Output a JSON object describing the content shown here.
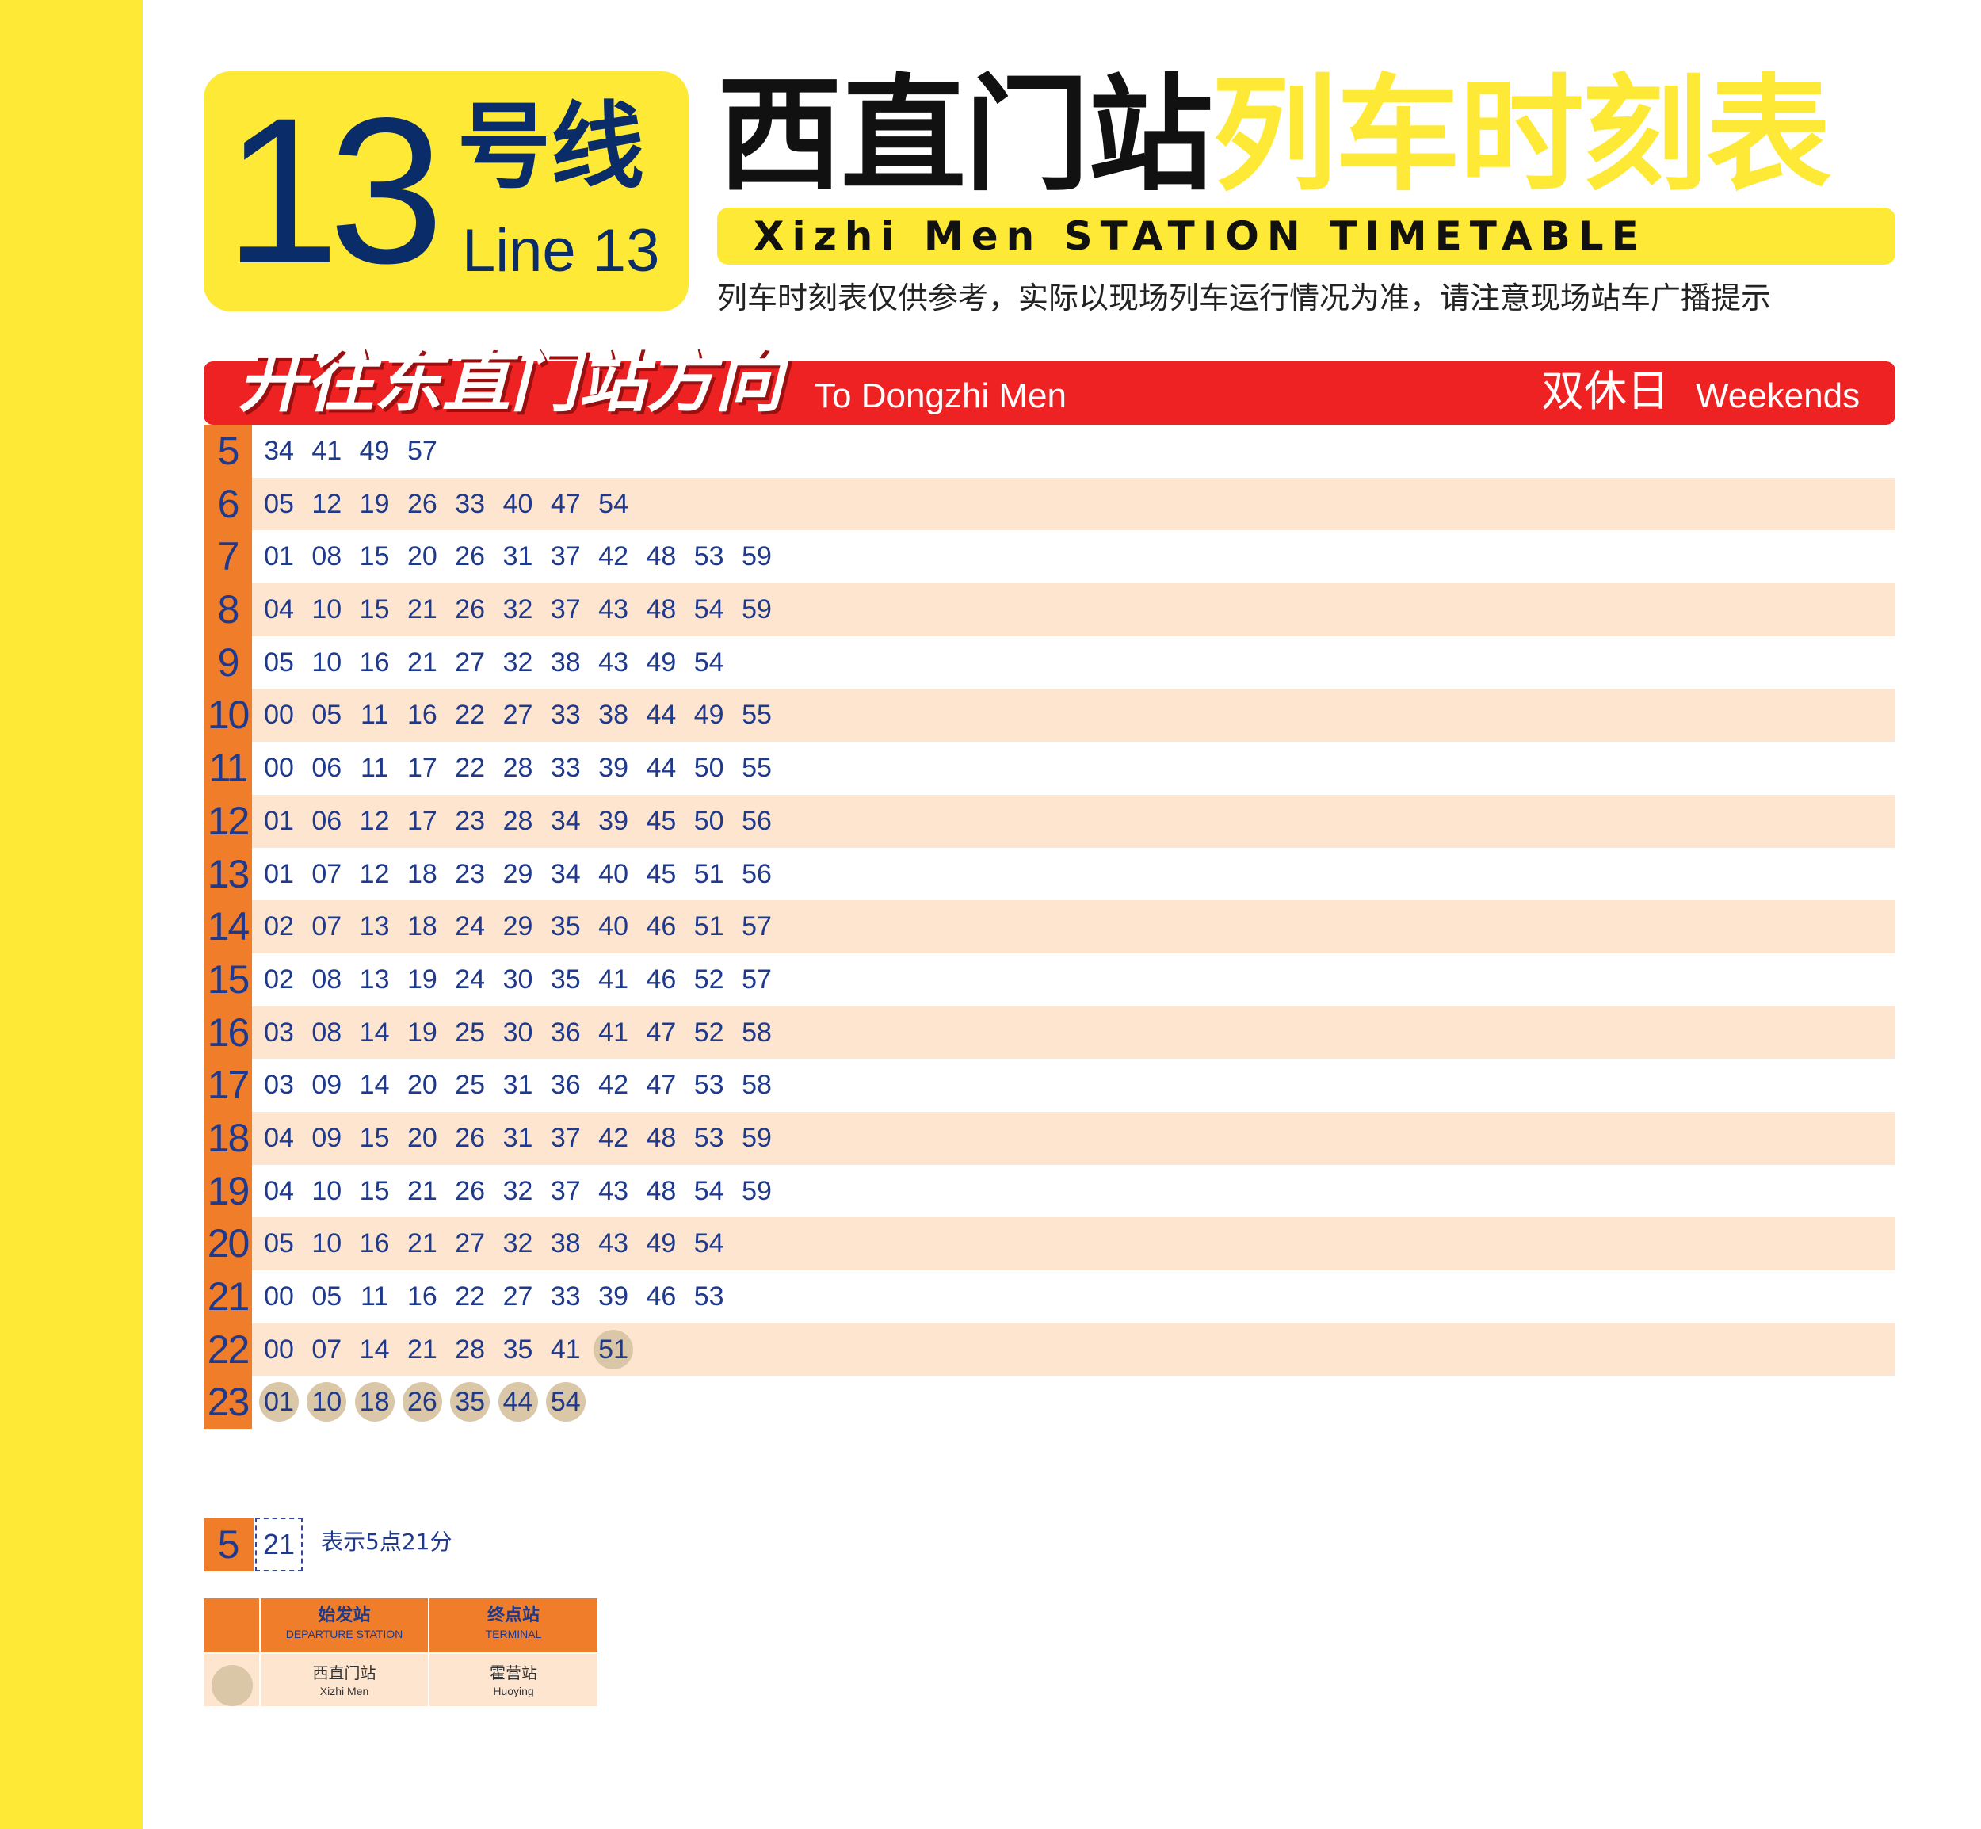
{
  "header": {
    "line_number": "13",
    "line_cn": "号线",
    "line_en": "Line 13",
    "station_cn": "西直门站",
    "timetable_cn": "列车时刻表",
    "title_en": "Xizhi Men STATION TIMETABLE",
    "notice": "列车时刻表仅供参考，实际以现场列车运行情况为准，请注意现场站车广播提示"
  },
  "direction": {
    "cn": "开往东直门站方向",
    "en": "To Dongzhi Men",
    "day_cn": "双休日",
    "day_en": "Weekends"
  },
  "timetable": [
    {
      "hour": "5",
      "minutes": [
        "34",
        "41",
        "49",
        "57"
      ],
      "circled": []
    },
    {
      "hour": "6",
      "minutes": [
        "05",
        "12",
        "19",
        "26",
        "33",
        "40",
        "47",
        "54"
      ],
      "circled": []
    },
    {
      "hour": "7",
      "minutes": [
        "01",
        "08",
        "15",
        "20",
        "26",
        "31",
        "37",
        "42",
        "48",
        "53",
        "59"
      ],
      "circled": []
    },
    {
      "hour": "8",
      "minutes": [
        "04",
        "10",
        "15",
        "21",
        "26",
        "32",
        "37",
        "43",
        "48",
        "54",
        "59"
      ],
      "circled": []
    },
    {
      "hour": "9",
      "minutes": [
        "05",
        "10",
        "16",
        "21",
        "27",
        "32",
        "38",
        "43",
        "49",
        "54"
      ],
      "circled": []
    },
    {
      "hour": "10",
      "minutes": [
        "00",
        "05",
        "11",
        "16",
        "22",
        "27",
        "33",
        "38",
        "44",
        "49",
        "55"
      ],
      "circled": []
    },
    {
      "hour": "11",
      "minutes": [
        "00",
        "06",
        "11",
        "17",
        "22",
        "28",
        "33",
        "39",
        "44",
        "50",
        "55"
      ],
      "circled": []
    },
    {
      "hour": "12",
      "minutes": [
        "01",
        "06",
        "12",
        "17",
        "23",
        "28",
        "34",
        "39",
        "45",
        "50",
        "56"
      ],
      "circled": []
    },
    {
      "hour": "13",
      "minutes": [
        "01",
        "07",
        "12",
        "18",
        "23",
        "29",
        "34",
        "40",
        "45",
        "51",
        "56"
      ],
      "circled": []
    },
    {
      "hour": "14",
      "minutes": [
        "02",
        "07",
        "13",
        "18",
        "24",
        "29",
        "35",
        "40",
        "46",
        "51",
        "57"
      ],
      "circled": []
    },
    {
      "hour": "15",
      "minutes": [
        "02",
        "08",
        "13",
        "19",
        "24",
        "30",
        "35",
        "41",
        "46",
        "52",
        "57"
      ],
      "circled": []
    },
    {
      "hour": "16",
      "minutes": [
        "03",
        "08",
        "14",
        "19",
        "25",
        "30",
        "36",
        "41",
        "47",
        "52",
        "58"
      ],
      "circled": []
    },
    {
      "hour": "17",
      "minutes": [
        "03",
        "09",
        "14",
        "20",
        "25",
        "31",
        "36",
        "42",
        "47",
        "53",
        "58"
      ],
      "circled": []
    },
    {
      "hour": "18",
      "minutes": [
        "04",
        "09",
        "15",
        "20",
        "26",
        "31",
        "37",
        "42",
        "48",
        "53",
        "59"
      ],
      "circled": []
    },
    {
      "hour": "19",
      "minutes": [
        "04",
        "10",
        "15",
        "21",
        "26",
        "32",
        "37",
        "43",
        "48",
        "54",
        "59"
      ],
      "circled": []
    },
    {
      "hour": "20",
      "minutes": [
        "05",
        "10",
        "16",
        "21",
        "27",
        "32",
        "38",
        "43",
        "49",
        "54"
      ],
      "circled": []
    },
    {
      "hour": "21",
      "minutes": [
        "00",
        "05",
        "11",
        "16",
        "22",
        "27",
        "33",
        "39",
        "46",
        "53"
      ],
      "circled": []
    },
    {
      "hour": "22",
      "minutes": [
        "00",
        "07",
        "14",
        "21",
        "28",
        "35",
        "41",
        "51"
      ],
      "circled": [
        7
      ]
    },
    {
      "hour": "23",
      "minutes": [
        "01",
        "10",
        "18",
        "26",
        "35",
        "44",
        "54"
      ],
      "circled": [
        0,
        1,
        2,
        3,
        4,
        5,
        6
      ]
    }
  ],
  "legend": {
    "hour": "5",
    "minute": "21",
    "text": "表示5点21分"
  },
  "station_table": {
    "departure_header_cn": "始发站",
    "departure_header_en": "DEPARTURE STATION",
    "terminal_header_cn": "终点站",
    "terminal_header_en": "TERMINAL",
    "departure_cn": "西直门站",
    "departure_en": "Xizhi Men",
    "terminal_cn": "霍营站",
    "terminal_en": "Huoying"
  },
  "colors": {
    "accent_yellow": "#FEEA36",
    "direction_red": "#EE2222",
    "hour_orange": "#F07D2A",
    "row_peach": "#FEE5CF",
    "text_blue": "#1f3a8c",
    "circle_tan": "#D9C7A7"
  }
}
